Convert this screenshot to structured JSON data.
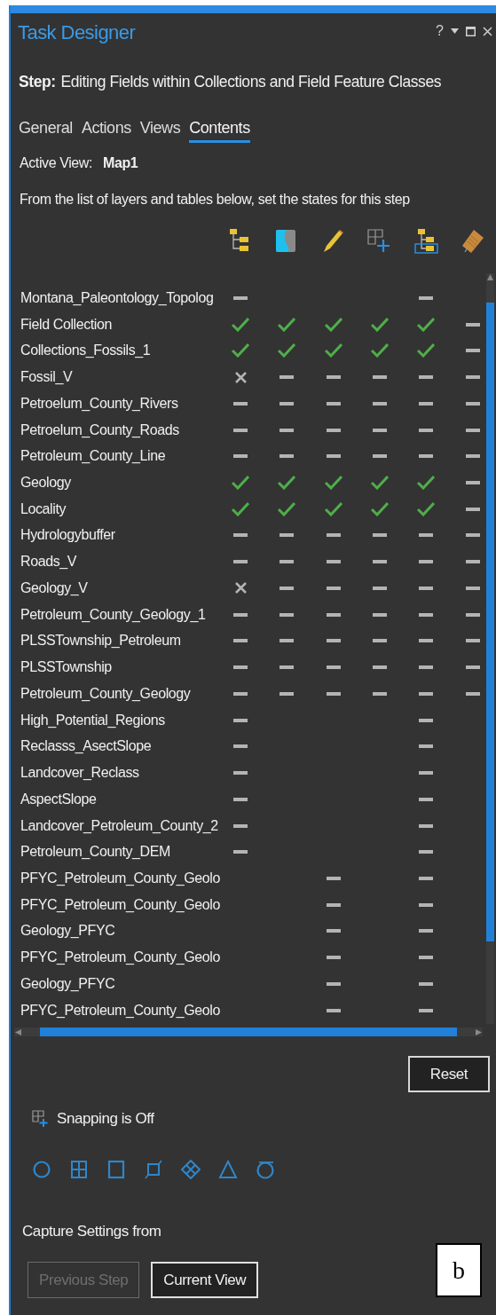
{
  "window": {
    "title": "Task Designer",
    "help": "?"
  },
  "step": {
    "label": "Step:",
    "value": "Editing Fields within Collections and Field Feature Classes"
  },
  "tabs": [
    {
      "label": "General",
      "selected": false
    },
    {
      "label": "Actions",
      "selected": false
    },
    {
      "label": "Views",
      "selected": false
    },
    {
      "label": "Contents",
      "selected": true
    }
  ],
  "active_view": {
    "label": "Active View:",
    "value": "Map1"
  },
  "instructions": "From the list of layers and tables below, set the states for this step",
  "columns": [
    {
      "kind": "hierarchy"
    },
    {
      "kind": "map"
    },
    {
      "kind": "pencil"
    },
    {
      "kind": "snap"
    },
    {
      "kind": "hierarchy-selected"
    },
    {
      "kind": "tag"
    }
  ],
  "layers": [
    {
      "name": "Montana_Paleontology_Topolog",
      "cells": [
        {
          "kind": "dash"
        },
        {
          "kind": "blank"
        },
        {
          "kind": "blank"
        },
        {
          "kind": "blank"
        },
        {
          "kind": "dash"
        },
        {
          "kind": "blank"
        }
      ]
    },
    {
      "name": "Field Collection",
      "cells": [
        {
          "kind": "check"
        },
        {
          "kind": "check"
        },
        {
          "kind": "check"
        },
        {
          "kind": "check"
        },
        {
          "kind": "check"
        },
        {
          "kind": "dash"
        }
      ]
    },
    {
      "name": "Collections_Fossils_1",
      "cells": [
        {
          "kind": "check"
        },
        {
          "kind": "check"
        },
        {
          "kind": "check"
        },
        {
          "kind": "check"
        },
        {
          "kind": "check"
        },
        {
          "kind": "dash"
        }
      ]
    },
    {
      "name": "Fossil_V",
      "cells": [
        {
          "kind": "cross"
        },
        {
          "kind": "dash"
        },
        {
          "kind": "dash"
        },
        {
          "kind": "dash"
        },
        {
          "kind": "dash"
        },
        {
          "kind": "dash"
        }
      ]
    },
    {
      "name": "Petroelum_County_Rivers",
      "cells": [
        {
          "kind": "dash"
        },
        {
          "kind": "dash"
        },
        {
          "kind": "dash"
        },
        {
          "kind": "dash"
        },
        {
          "kind": "dash"
        },
        {
          "kind": "dash"
        }
      ]
    },
    {
      "name": "Petroelum_County_Roads",
      "cells": [
        {
          "kind": "dash"
        },
        {
          "kind": "dash"
        },
        {
          "kind": "dash"
        },
        {
          "kind": "dash"
        },
        {
          "kind": "dash"
        },
        {
          "kind": "dash"
        }
      ]
    },
    {
      "name": "Petroleum_County_Line",
      "cells": [
        {
          "kind": "dash"
        },
        {
          "kind": "dash"
        },
        {
          "kind": "dash"
        },
        {
          "kind": "dash"
        },
        {
          "kind": "dash"
        },
        {
          "kind": "dash"
        }
      ]
    },
    {
      "name": "Geology",
      "cells": [
        {
          "kind": "check"
        },
        {
          "kind": "check"
        },
        {
          "kind": "check"
        },
        {
          "kind": "check"
        },
        {
          "kind": "check"
        },
        {
          "kind": "dash"
        }
      ]
    },
    {
      "name": "Locality",
      "cells": [
        {
          "kind": "check"
        },
        {
          "kind": "check"
        },
        {
          "kind": "check"
        },
        {
          "kind": "check"
        },
        {
          "kind": "check"
        },
        {
          "kind": "dash"
        }
      ]
    },
    {
      "name": "Hydrologybuffer",
      "cells": [
        {
          "kind": "dash"
        },
        {
          "kind": "dash"
        },
        {
          "kind": "dash"
        },
        {
          "kind": "dash"
        },
        {
          "kind": "dash"
        },
        {
          "kind": "dash"
        }
      ]
    },
    {
      "name": "Roads_V",
      "cells": [
        {
          "kind": "dash"
        },
        {
          "kind": "dash"
        },
        {
          "kind": "dash"
        },
        {
          "kind": "dash"
        },
        {
          "kind": "dash"
        },
        {
          "kind": "dash"
        }
      ]
    },
    {
      "name": "Geology_V",
      "cells": [
        {
          "kind": "cross"
        },
        {
          "kind": "dash"
        },
        {
          "kind": "dash"
        },
        {
          "kind": "dash"
        },
        {
          "kind": "dash"
        },
        {
          "kind": "dash"
        }
      ]
    },
    {
      "name": "Petroleum_County_Geology_1",
      "cells": [
        {
          "kind": "dash"
        },
        {
          "kind": "dash"
        },
        {
          "kind": "dash"
        },
        {
          "kind": "dash"
        },
        {
          "kind": "dash"
        },
        {
          "kind": "dash"
        }
      ]
    },
    {
      "name": "PLSSTownship_Petroleum",
      "cells": [
        {
          "kind": "dash"
        },
        {
          "kind": "dash"
        },
        {
          "kind": "dash"
        },
        {
          "kind": "dash"
        },
        {
          "kind": "dash"
        },
        {
          "kind": "dash"
        }
      ]
    },
    {
      "name": "PLSSTownship",
      "cells": [
        {
          "kind": "dash"
        },
        {
          "kind": "dash"
        },
        {
          "kind": "dash"
        },
        {
          "kind": "dash"
        },
        {
          "kind": "dash"
        },
        {
          "kind": "dash"
        }
      ]
    },
    {
      "name": "Petroleum_County_Geology",
      "cells": [
        {
          "kind": "dash"
        },
        {
          "kind": "dash"
        },
        {
          "kind": "dash"
        },
        {
          "kind": "dash"
        },
        {
          "kind": "dash"
        },
        {
          "kind": "dash"
        }
      ]
    },
    {
      "name": "High_Potential_Regions",
      "cells": [
        {
          "kind": "dash"
        },
        {
          "kind": "blank"
        },
        {
          "kind": "blank"
        },
        {
          "kind": "blank"
        },
        {
          "kind": "dash"
        },
        {
          "kind": "blank"
        }
      ]
    },
    {
      "name": "Reclasss_AsectSlope",
      "cells": [
        {
          "kind": "dash"
        },
        {
          "kind": "blank"
        },
        {
          "kind": "blank"
        },
        {
          "kind": "blank"
        },
        {
          "kind": "dash"
        },
        {
          "kind": "blank"
        }
      ]
    },
    {
      "name": "Landcover_Reclass",
      "cells": [
        {
          "kind": "dash"
        },
        {
          "kind": "blank"
        },
        {
          "kind": "blank"
        },
        {
          "kind": "blank"
        },
        {
          "kind": "dash"
        },
        {
          "kind": "blank"
        }
      ]
    },
    {
      "name": "AspectSlope",
      "cells": [
        {
          "kind": "dash"
        },
        {
          "kind": "blank"
        },
        {
          "kind": "blank"
        },
        {
          "kind": "blank"
        },
        {
          "kind": "dash"
        },
        {
          "kind": "blank"
        }
      ]
    },
    {
      "name": "Landcover_Petroleum_County_2",
      "cells": [
        {
          "kind": "dash"
        },
        {
          "kind": "blank"
        },
        {
          "kind": "blank"
        },
        {
          "kind": "blank"
        },
        {
          "kind": "dash"
        },
        {
          "kind": "blank"
        }
      ]
    },
    {
      "name": "Petroleum_County_DEM",
      "cells": [
        {
          "kind": "dash"
        },
        {
          "kind": "blank"
        },
        {
          "kind": "blank"
        },
        {
          "kind": "blank"
        },
        {
          "kind": "dash"
        },
        {
          "kind": "blank"
        }
      ]
    },
    {
      "name": "PFYC_Petroleum_County_Geolo",
      "cells": [
        {
          "kind": "blank"
        },
        {
          "kind": "blank"
        },
        {
          "kind": "dash"
        },
        {
          "kind": "blank"
        },
        {
          "kind": "dash"
        },
        {
          "kind": "blank"
        }
      ]
    },
    {
      "name": "PFYC_Petroleum_County_Geolo",
      "cells": [
        {
          "kind": "blank"
        },
        {
          "kind": "blank"
        },
        {
          "kind": "dash"
        },
        {
          "kind": "blank"
        },
        {
          "kind": "dash"
        },
        {
          "kind": "blank"
        }
      ]
    },
    {
      "name": "Geology_PFYC",
      "cells": [
        {
          "kind": "blank"
        },
        {
          "kind": "blank"
        },
        {
          "kind": "dash"
        },
        {
          "kind": "blank"
        },
        {
          "kind": "dash"
        },
        {
          "kind": "blank"
        }
      ]
    },
    {
      "name": "PFYC_Petroleum_County_Geolo",
      "cells": [
        {
          "kind": "blank"
        },
        {
          "kind": "blank"
        },
        {
          "kind": "dash"
        },
        {
          "kind": "blank"
        },
        {
          "kind": "dash"
        },
        {
          "kind": "blank"
        }
      ]
    },
    {
      "name": "Geology_PFYC",
      "cells": [
        {
          "kind": "blank"
        },
        {
          "kind": "blank"
        },
        {
          "kind": "dash"
        },
        {
          "kind": "blank"
        },
        {
          "kind": "dash"
        },
        {
          "kind": "blank"
        }
      ]
    },
    {
      "name": "PFYC_Petroleum_County_Geolo",
      "cells": [
        {
          "kind": "blank"
        },
        {
          "kind": "blank"
        },
        {
          "kind": "dash"
        },
        {
          "kind": "blank"
        },
        {
          "kind": "dash"
        },
        {
          "kind": "blank"
        }
      ]
    }
  ],
  "reset_button": "Reset",
  "snapping": {
    "text": "Snapping is Off"
  },
  "snap_tools": [
    {
      "kind": "point"
    },
    {
      "kind": "vertex"
    },
    {
      "kind": "edge"
    },
    {
      "kind": "end"
    },
    {
      "kind": "intersection"
    },
    {
      "kind": "midpoint"
    },
    {
      "kind": "tangent"
    }
  ],
  "capture": {
    "label": "Capture Settings from",
    "buttons": [
      {
        "label": "Previous Step",
        "disabled": true
      },
      {
        "label": "Current View",
        "disabled": false
      }
    ]
  },
  "panel_label": "b"
}
